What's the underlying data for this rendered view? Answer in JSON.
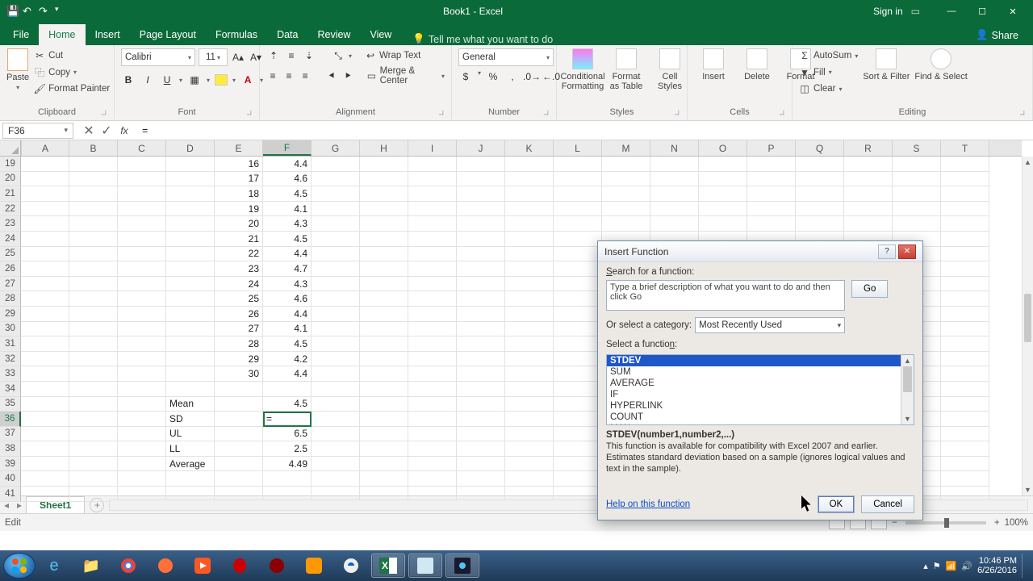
{
  "app": {
    "title": "Book1 - Excel",
    "signin": "Sign in"
  },
  "tabs": {
    "file": "File",
    "home": "Home",
    "insert": "Insert",
    "pagelayout": "Page Layout",
    "formulas": "Formulas",
    "data": "Data",
    "review": "Review",
    "view": "View",
    "tellme": "Tell me what you want to do",
    "share": "Share"
  },
  "ribbon": {
    "clipboard": {
      "label": "Clipboard",
      "paste": "Paste",
      "cut": "Cut",
      "copy": "Copy",
      "painter": "Format Painter"
    },
    "font": {
      "label": "Font",
      "name": "Calibri",
      "size": "11"
    },
    "alignment": {
      "label": "Alignment",
      "wrap": "Wrap Text",
      "merge": "Merge & Center"
    },
    "number": {
      "label": "Number",
      "format": "General"
    },
    "styles": {
      "label": "Styles",
      "cond": "Conditional Formatting",
      "table": "Format as Table",
      "cell": "Cell Styles"
    },
    "cells": {
      "label": "Cells",
      "insert": "Insert",
      "delete": "Delete",
      "format": "Format"
    },
    "editing": {
      "label": "Editing",
      "autosum": "AutoSum",
      "fill": "Fill",
      "clear": "Clear",
      "sort": "Sort & Filter",
      "find": "Find & Select"
    }
  },
  "namebox": "F36",
  "formula": "=",
  "columns": [
    "A",
    "B",
    "C",
    "D",
    "E",
    "F",
    "G",
    "H",
    "I",
    "J",
    "K",
    "L",
    "M",
    "N",
    "O",
    "P",
    "Q",
    "R",
    "S",
    "T"
  ],
  "rows": [
    {
      "n": 19,
      "E": "16",
      "F": "4.4"
    },
    {
      "n": 20,
      "E": "17",
      "F": "4.6"
    },
    {
      "n": 21,
      "E": "18",
      "F": "4.5"
    },
    {
      "n": 22,
      "E": "19",
      "F": "4.1"
    },
    {
      "n": 23,
      "E": "20",
      "F": "4.3"
    },
    {
      "n": 24,
      "E": "21",
      "F": "4.5"
    },
    {
      "n": 25,
      "E": "22",
      "F": "4.4"
    },
    {
      "n": 26,
      "E": "23",
      "F": "4.7"
    },
    {
      "n": 27,
      "E": "24",
      "F": "4.3"
    },
    {
      "n": 28,
      "E": "25",
      "F": "4.6"
    },
    {
      "n": 29,
      "E": "26",
      "F": "4.4"
    },
    {
      "n": 30,
      "E": "27",
      "F": "4.1"
    },
    {
      "n": 31,
      "E": "28",
      "F": "4.5"
    },
    {
      "n": 32,
      "E": "29",
      "F": "4.2"
    },
    {
      "n": 33,
      "E": "30",
      "F": "4.4"
    },
    {
      "n": 34
    },
    {
      "n": 35,
      "D": "Mean",
      "F": "4.5"
    },
    {
      "n": 36,
      "D": "SD",
      "F": "=",
      "active": true
    },
    {
      "n": 37,
      "D": "UL",
      "F": "6.5"
    },
    {
      "n": 38,
      "D": "LL",
      "F": "2.5"
    },
    {
      "n": 39,
      "D": "Average",
      "F": "4.49"
    },
    {
      "n": 40
    },
    {
      "n": 41
    }
  ],
  "sheet": {
    "name": "Sheet1"
  },
  "status": {
    "mode": "Edit",
    "zoom": "100%"
  },
  "dialog": {
    "title": "Insert Function",
    "search_label": "Search for a function:",
    "search_text": "Type a brief description of what you want to do and then click Go",
    "go": "Go",
    "category_label": "Or select a category:",
    "category": "Most Recently Used",
    "select_label": "Select a function:",
    "items": [
      "STDEV",
      "SUM",
      "AVERAGE",
      "IF",
      "HYPERLINK",
      "COUNT",
      "MAX"
    ],
    "signature": "STDEV(number1,number2,...)",
    "description": "This function is available for compatibility with Excel 2007 and earlier. Estimates standard deviation based on a sample (ignores logical values and text in the sample).",
    "help": "Help on this function",
    "ok": "OK",
    "cancel": "Cancel"
  },
  "clock": {
    "time": "10:46 PM",
    "date": "6/26/2016"
  }
}
